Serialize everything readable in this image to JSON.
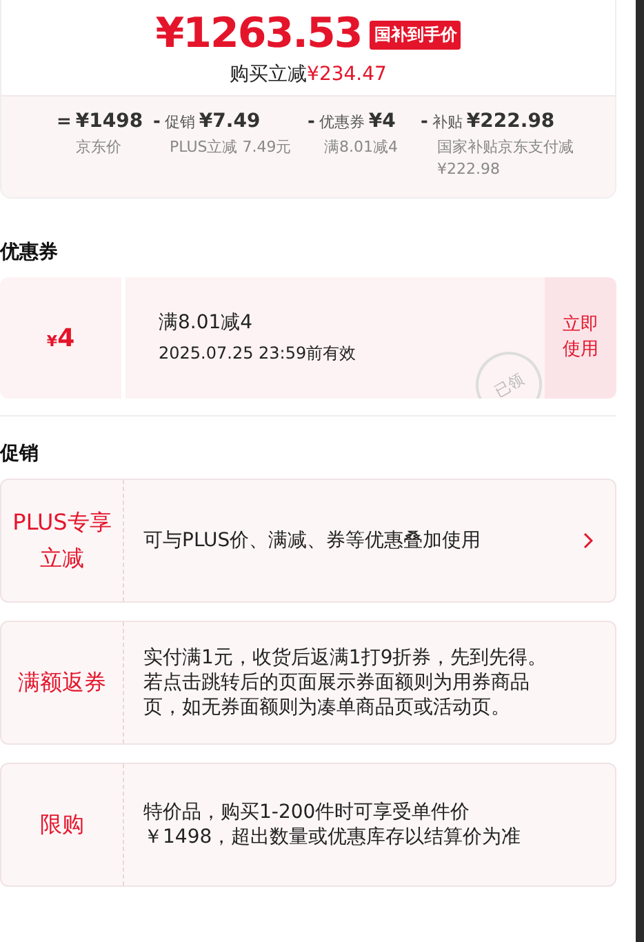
{
  "price": {
    "amount": "¥1263.53",
    "badge": "国补到手价",
    "saving_label": "购买立减",
    "saving_value": "¥234.47"
  },
  "breakdown": [
    {
      "operator": "=",
      "value": "¥1498",
      "note": "京东价"
    },
    {
      "operator": "-",
      "name": "促销",
      "value": "¥7.49",
      "note": "PLUS立减 7.49元"
    },
    {
      "operator": "-",
      "name": "优惠券",
      "value": "¥4",
      "note": "满8.01减4"
    },
    {
      "operator": "-",
      "name": "补贴",
      "value": "¥222.98",
      "note": "国家补贴京东支付减¥222.98"
    }
  ],
  "coupon_section": {
    "title": "优惠券",
    "coupons": [
      {
        "currency": "¥",
        "amount": "4",
        "condition": "满8.01减4",
        "validity": "2025.07.25 23:59前有效",
        "stamp": "已领",
        "action": "立即使用"
      }
    ]
  },
  "promo_section": {
    "title": "促销",
    "promos": [
      {
        "label": "PLUS专享立减",
        "text": "可与PLUS价、满减、券等优惠叠加使用",
        "has_arrow": true
      },
      {
        "label": "满额返券",
        "text": "实付满1元，收货后返满1打9折券，先到先得。若点击跳转后的页面展示券面额则为用券商品页，如无券面额则为凑单商品页或活动页。",
        "has_arrow": false
      },
      {
        "label": "限购",
        "text": "特价品，购买1-200件时可享受单件价￥1498，超出数量或优惠库存以结算价为准",
        "has_arrow": false
      }
    ]
  }
}
